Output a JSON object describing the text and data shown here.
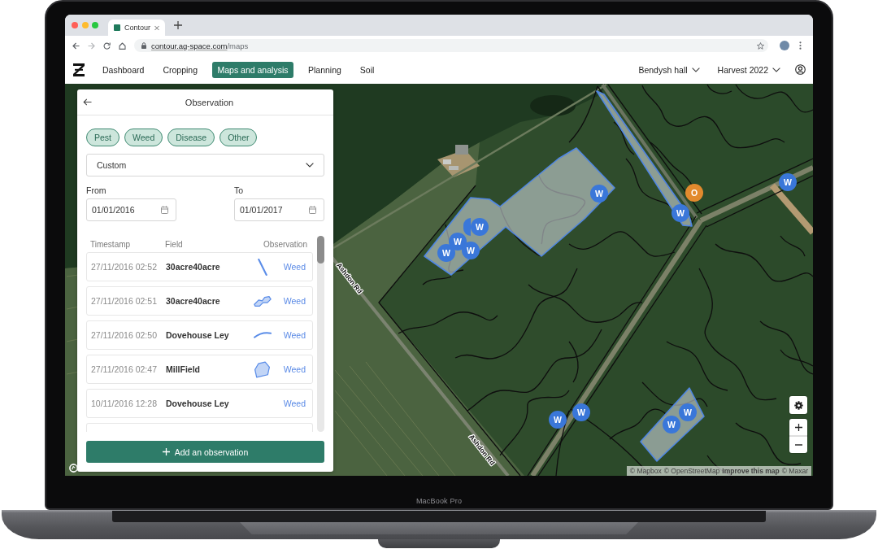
{
  "device": {
    "label": "MacBook Pro"
  },
  "browser": {
    "tab": {
      "title": "Contour"
    },
    "url": {
      "host": "contour.ag-space.com",
      "path": "/maps"
    }
  },
  "app_nav": {
    "items": [
      {
        "label": "Dashboard",
        "selected": false
      },
      {
        "label": "Cropping",
        "selected": false
      },
      {
        "label": "Maps and analysis",
        "selected": true
      },
      {
        "label": "Planning",
        "selected": false
      },
      {
        "label": "Soil",
        "selected": false
      }
    ],
    "selectors": [
      {
        "label": "Bendysh hall"
      },
      {
        "label": "Harvest 2022"
      }
    ]
  },
  "panel": {
    "title": "Observation",
    "filters": [
      {
        "label": "Pest",
        "selected": true
      },
      {
        "label": "Weed",
        "selected": true
      },
      {
        "label": "Disease",
        "selected": true
      },
      {
        "label": "Other",
        "selected": true
      }
    ],
    "period": {
      "value": "Custom"
    },
    "date_range": [
      {
        "label": "From",
        "value": "01/01/2016"
      },
      {
        "label": "To",
        "value": "01/01/2017"
      }
    ],
    "table": {
      "columns": [
        "Timestamp",
        "Field",
        "Observation"
      ],
      "rows": [
        {
          "kind": "entry",
          "timestamp": "27/11/2016 02:52",
          "field": "30acre40acre",
          "geometry": {
            "kind": "line"
          },
          "observation": "Weed"
        },
        {
          "kind": "entry",
          "timestamp": "27/11/2016 02:51",
          "field": "30acre40acre",
          "geometry": {
            "kind": "double-polygon"
          },
          "observation": "Weed"
        },
        {
          "kind": "entry",
          "timestamp": "27/11/2016 02:50",
          "field": "Dovehouse Ley",
          "geometry": {
            "kind": "arc"
          },
          "observation": "Weed"
        },
        {
          "kind": "entry",
          "timestamp": "27/11/2016 02:47",
          "field": "MillField",
          "geometry": {
            "kind": "polygon"
          },
          "observation": "Weed"
        },
        {
          "kind": "entry",
          "timestamp": "10/11/2016 12:28",
          "field": "Dovehouse Ley",
          "observation": "Weed"
        },
        {
          "kind": "cut-off"
        }
      ]
    },
    "add_button": {
      "label": "Add an observation"
    }
  },
  "map": {
    "markers": [
      {
        "color": "#3a77d9"
      },
      {
        "label": "W",
        "color": "#3a77d9"
      },
      {
        "label": "W",
        "color": "#3a77d9"
      },
      {
        "label": "W",
        "color": "#3a77d9"
      },
      {
        "label": "W",
        "color": "#3a77d9"
      },
      {
        "label": "W",
        "color": "#3a77d9"
      },
      {
        "label": "W",
        "color": "#3a77d9"
      },
      {
        "label": "O",
        "color": "#e28a2e"
      },
      {
        "label": "W",
        "color": "#3a77d9"
      },
      {
        "label": "W",
        "color": "#3a77d9"
      },
      {
        "label": "W",
        "color": "#3a77d9"
      },
      {
        "label": "W",
        "color": "#3a77d9"
      },
      {
        "label": "W",
        "color": "#3a77d9"
      }
    ],
    "road_labels": [
      "Ashdon Rd",
      "Ashdon Rd"
    ],
    "attribution": [
      {
        "text": "© Mapbox",
        "kind": "plain"
      },
      {
        "text": "© OpenStreetMap",
        "kind": "plain"
      },
      {
        "text": "Improve this map",
        "kind": "strong"
      },
      {
        "text": "© Maxar",
        "kind": "plain"
      }
    ]
  }
}
